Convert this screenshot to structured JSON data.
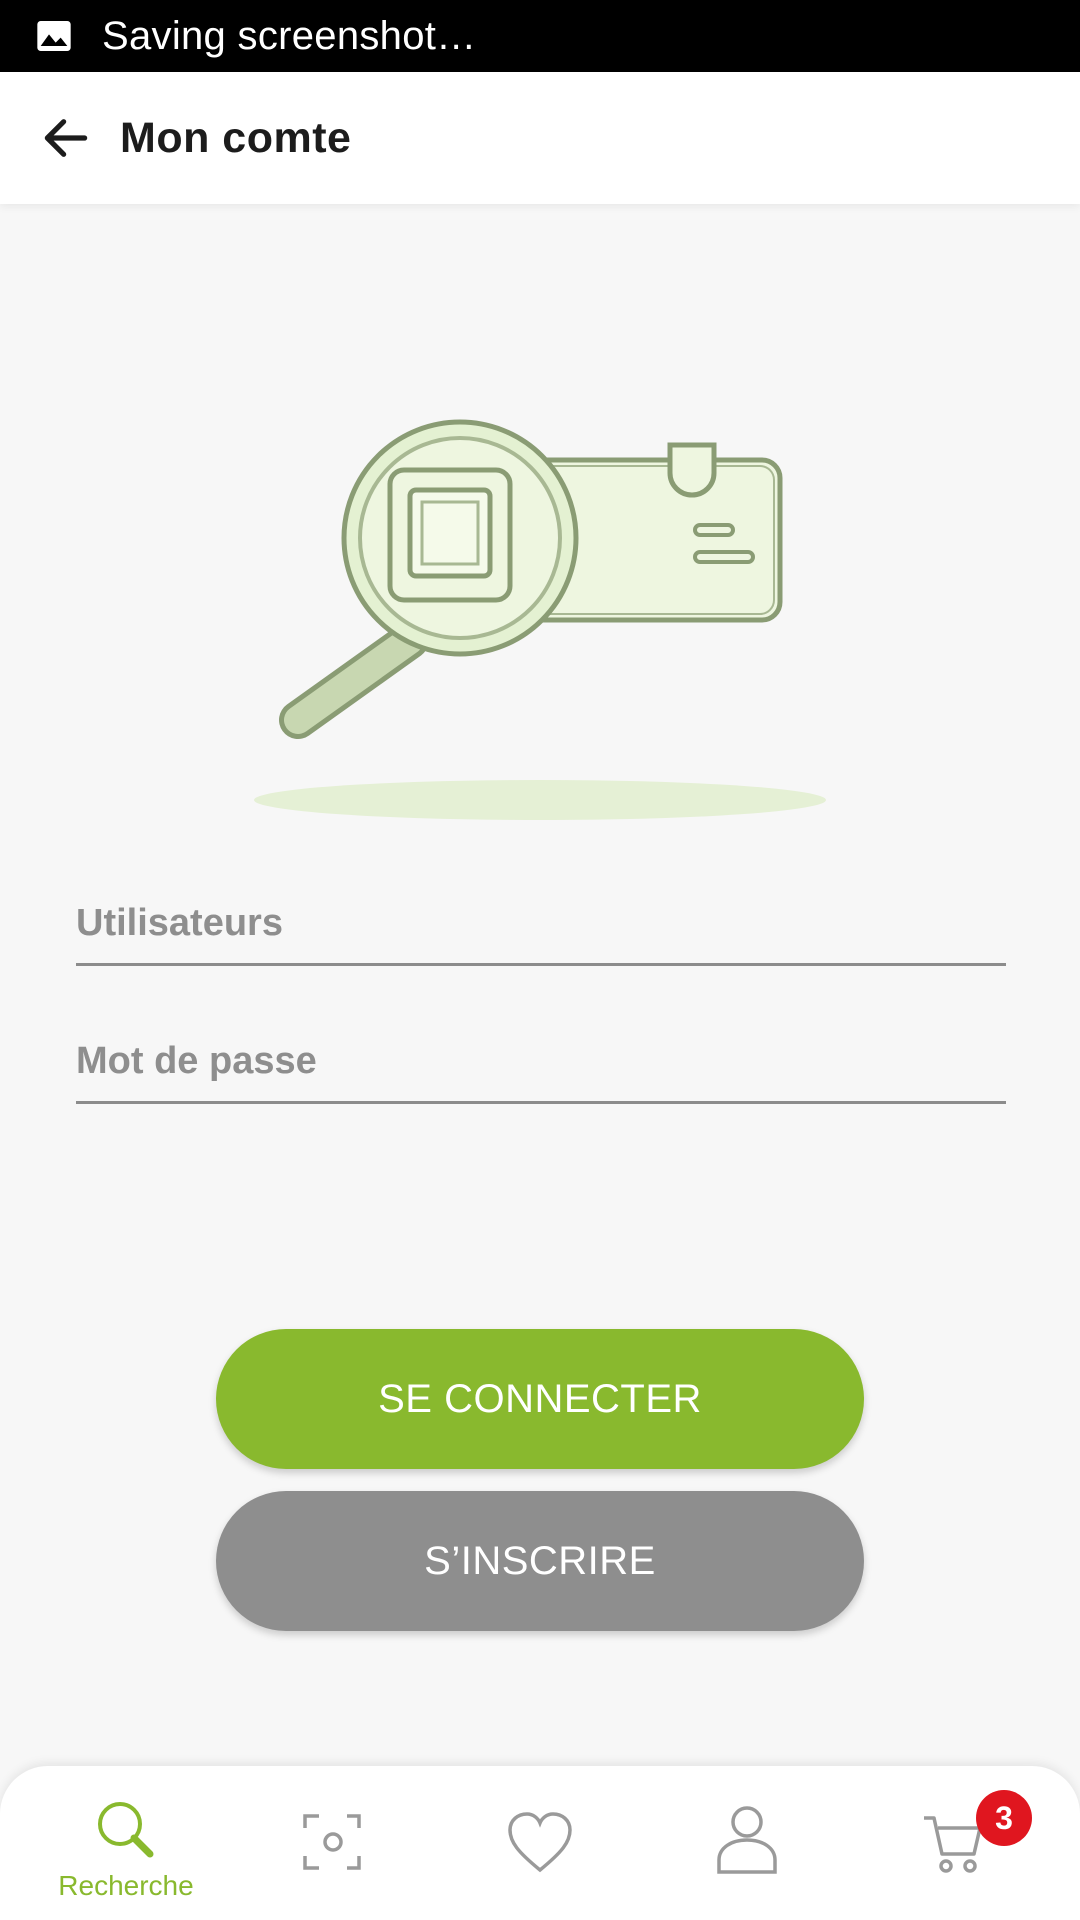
{
  "status_bar": {
    "icon": "image-icon",
    "text": "Saving screenshot…"
  },
  "app_bar": {
    "back_icon": "arrow-left-icon",
    "title": "Mon comte"
  },
  "illustration": {
    "icon": "magnifier-id-card-illustration"
  },
  "form": {
    "username_placeholder": "Utilisateurs",
    "password_placeholder": "Mot de passe"
  },
  "buttons": {
    "login": "SE CONNECTER",
    "signup": "S’INSCRIRE"
  },
  "bottom_nav": {
    "items": [
      {
        "icon": "search-icon",
        "label": "Recherche",
        "active": true
      },
      {
        "icon": "scan-icon",
        "label": ""
      },
      {
        "icon": "heart-icon",
        "label": ""
      },
      {
        "icon": "user-icon",
        "label": ""
      },
      {
        "icon": "cart-icon",
        "label": "",
        "badge": "3"
      }
    ]
  },
  "colors": {
    "accent": "#89b92e",
    "secondary": "#8e8e8e",
    "badge": "#e0161f"
  }
}
